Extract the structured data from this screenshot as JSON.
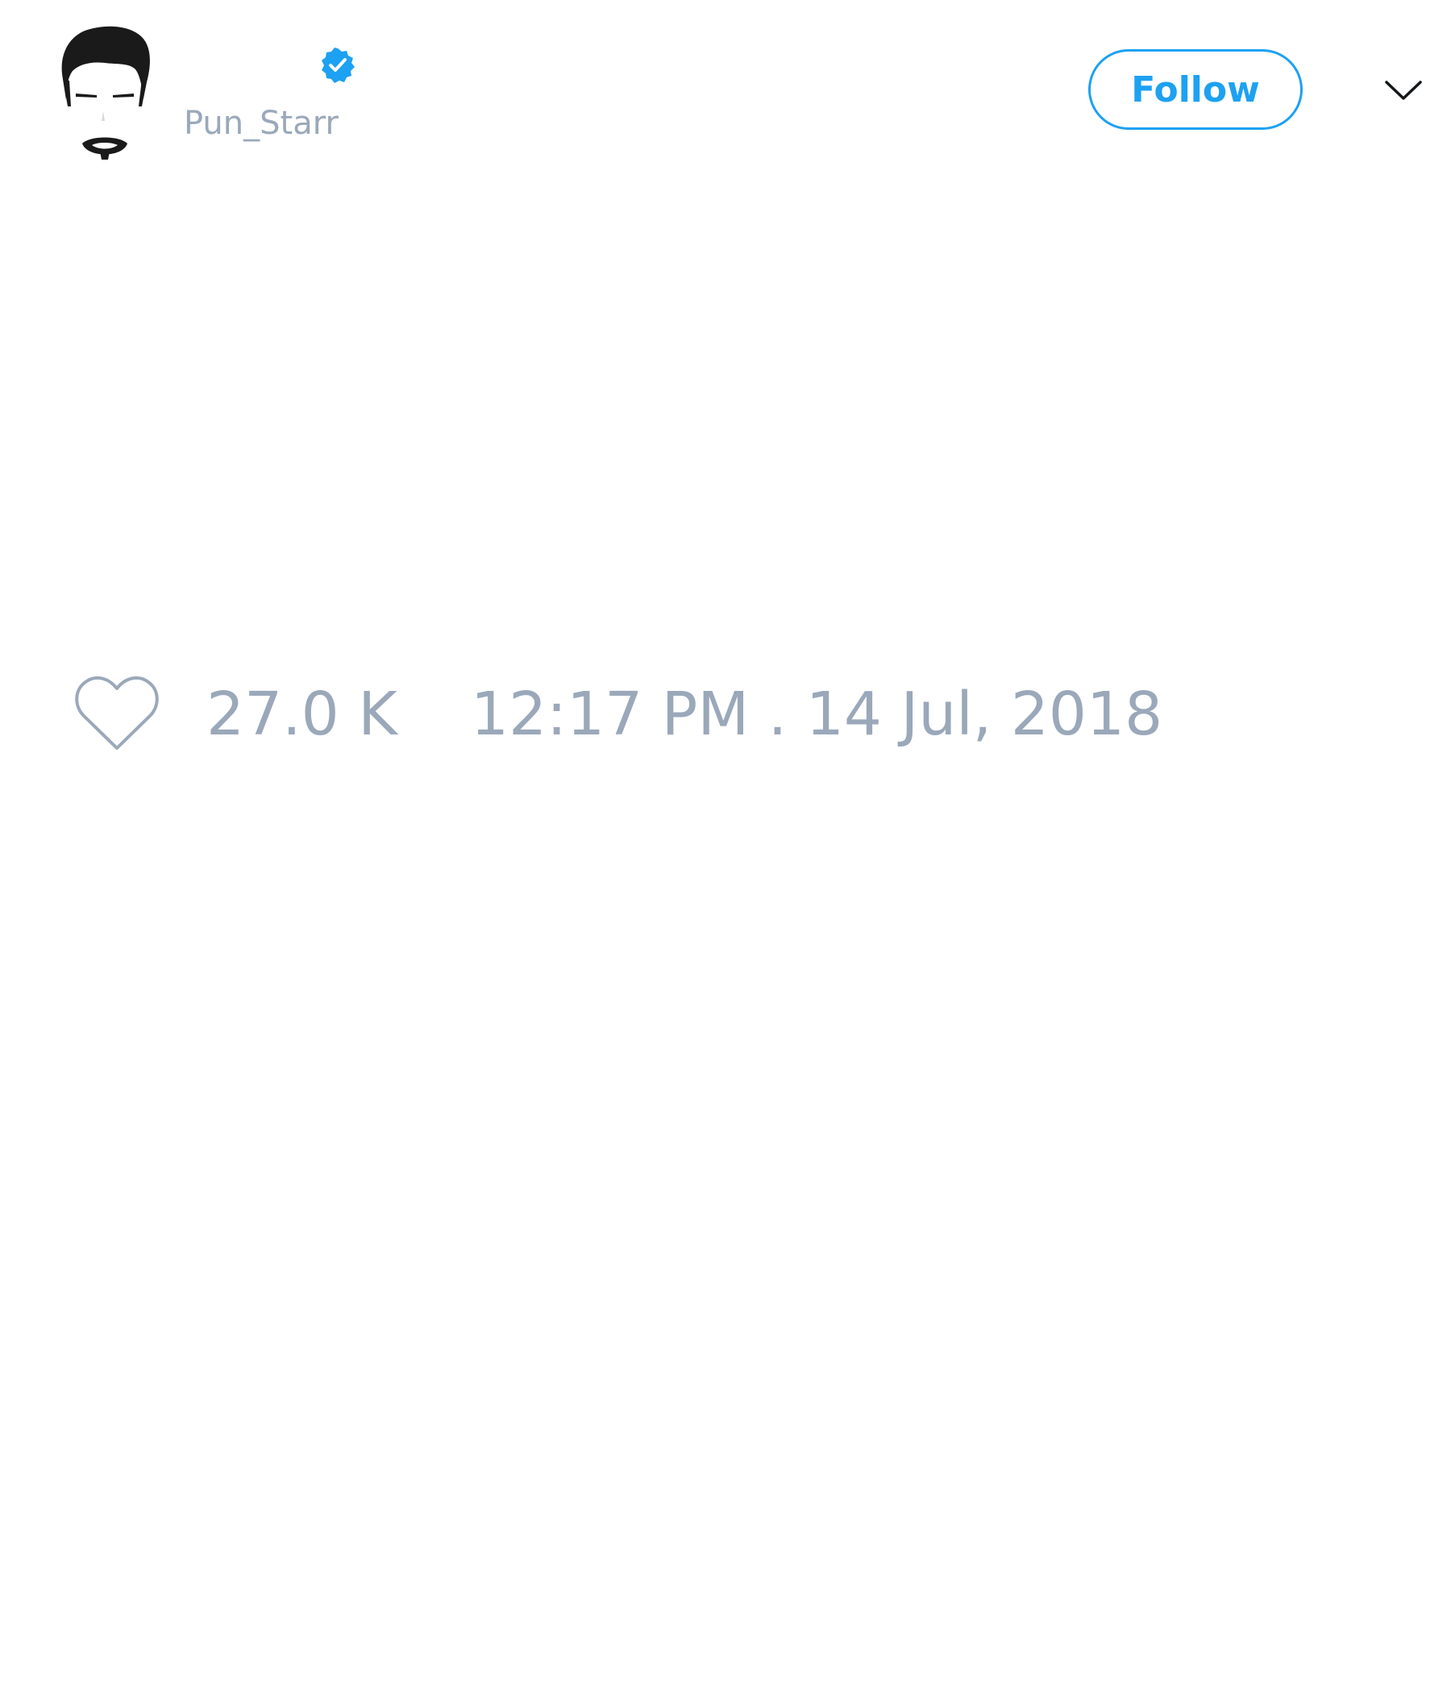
{
  "tweet": {
    "author": {
      "display_name": "",
      "username": "Pun_Starr",
      "verified": true,
      "avatar_icon": "cartoon-face-avatar",
      "verified_icon": "verified-badge-icon"
    },
    "follow_label": "Follow",
    "menu_icon": "chevron-down-icon",
    "likes": {
      "icon": "heart-icon",
      "count": "27.0 K"
    },
    "timestamp": "12:17 PM . 14 Jul, 2018"
  },
  "colors": {
    "accent": "#1da1f2",
    "muted_text": "#9aa8ba",
    "background": "#ffffff"
  }
}
